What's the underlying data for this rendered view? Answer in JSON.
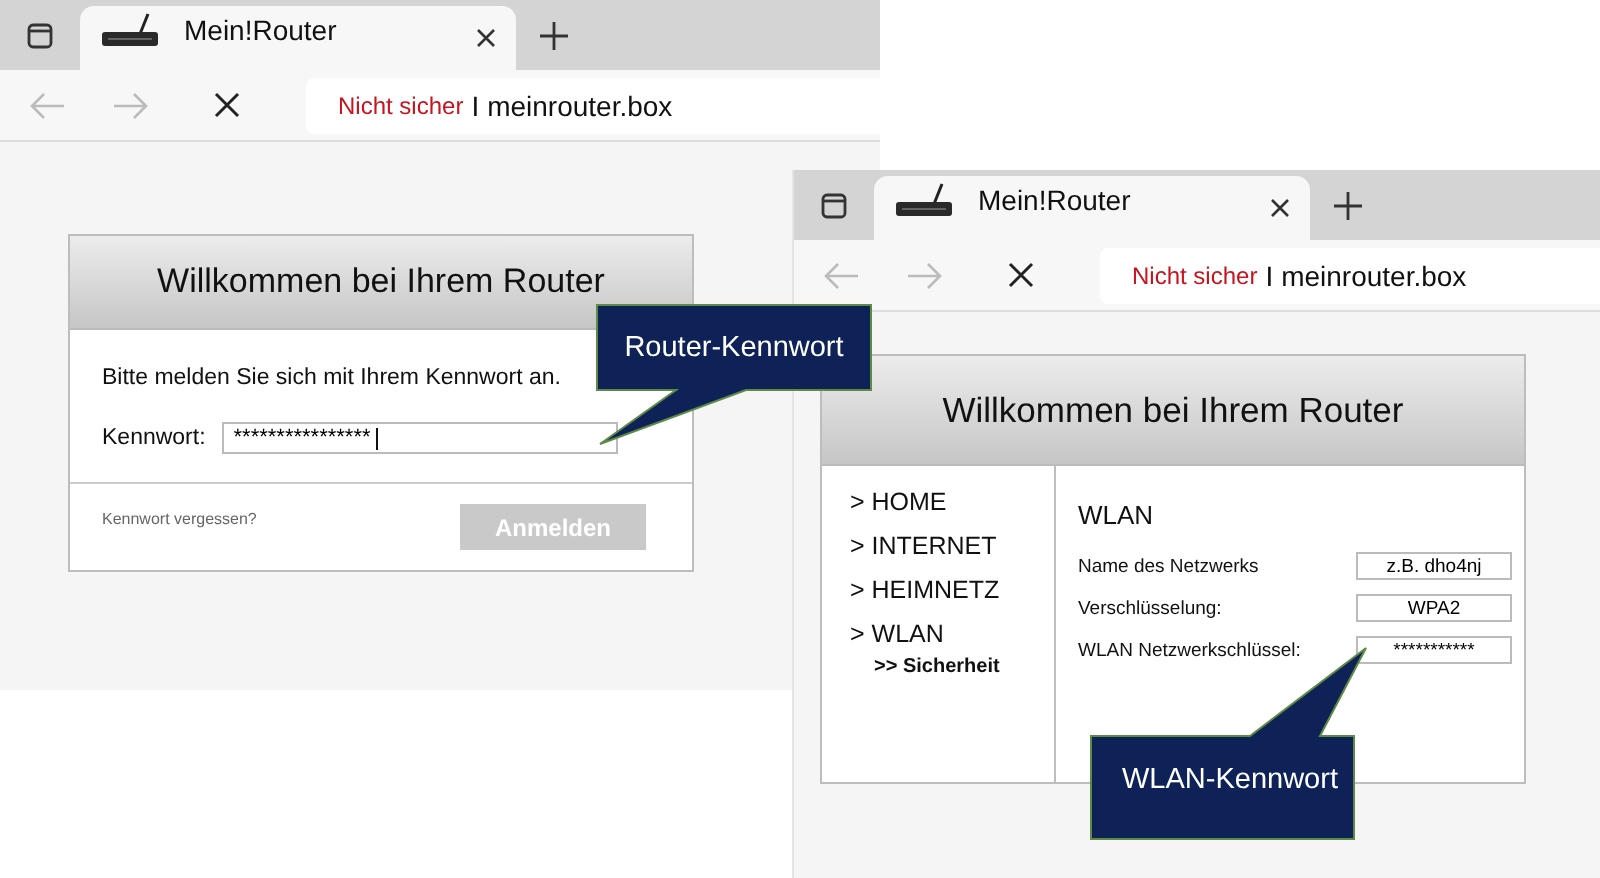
{
  "windows": [
    {
      "tab": {
        "title": "Mein!Router",
        "selected": true
      },
      "address": {
        "warning": "Nicht sicher",
        "separator": "I",
        "url": "meinrouter.box"
      },
      "page": {
        "kind": "login",
        "title": "Willkommen bei Ihrem Router",
        "prompt": "Bitte melden Sie sich mit Ihrem Kennwort an.",
        "field": {
          "label": "Kennwort:",
          "value": "****************"
        },
        "link": "Kennwort vergessen?",
        "button": {
          "label": "Anmelden",
          "disabled": true
        }
      }
    },
    {
      "tab": {
        "title": "Mein!Router",
        "selected": true
      },
      "address": {
        "warning": "Nicht sicher",
        "separator": "I",
        "url": "meinrouter.box"
      },
      "page": {
        "kind": "settings",
        "title": "Willkommen bei Ihrem Router",
        "nav": [
          {
            "label": "> HOME"
          },
          {
            "label": "> INTERNET"
          },
          {
            "label": "> HEIMNETZ"
          },
          {
            "label": "> WLAN",
            "children": [
              {
                "label": ">> Sicherheit"
              }
            ]
          }
        ],
        "section": "WLAN",
        "fields": [
          {
            "label": "Name des Netzwerks",
            "value": "z.B. dho4nj"
          },
          {
            "label": "Verschlüsselung:",
            "value": "WPA2"
          },
          {
            "label": "WLAN Netzwerkschlüssel:",
            "value": "***********"
          }
        ]
      }
    }
  ],
  "callouts": [
    {
      "text": "Router-Kennwort"
    },
    {
      "text": "WLAN-Kennwort"
    }
  ]
}
